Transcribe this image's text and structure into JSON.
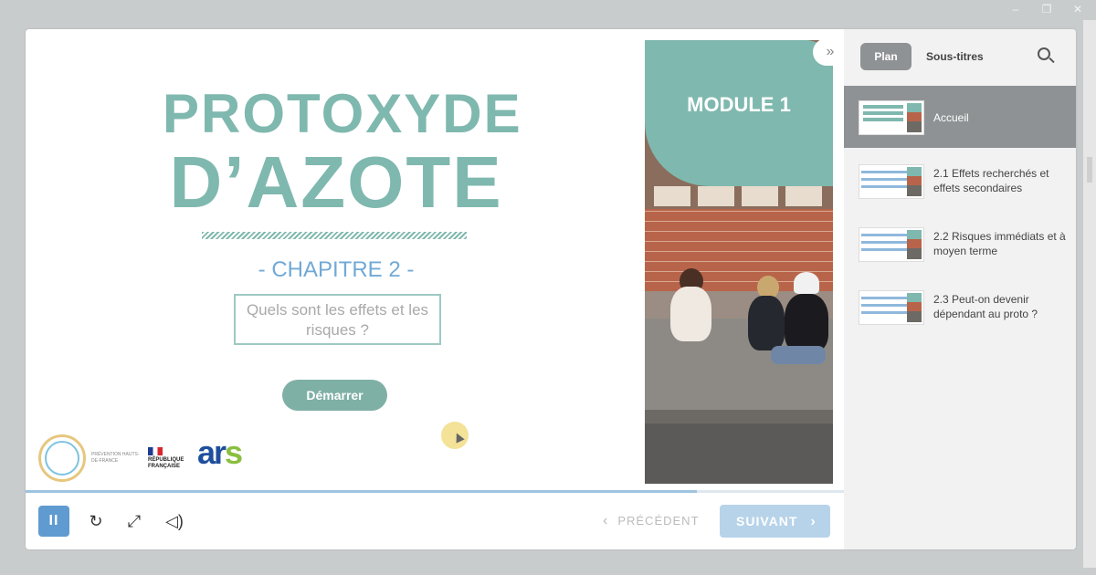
{
  "window": {
    "controls": [
      "–",
      "❐",
      "✕"
    ]
  },
  "slide": {
    "title_line1": "PROTOXYDE",
    "title_line2": "D’AZOTE",
    "chapter": "- CHAPITRE 2 -",
    "question": "Quels sont les effets et les risques ?",
    "start_button": "Démarrer",
    "module_badge": "MODULE 1",
    "logos": {
      "prevention": "PRÉVENTION HAUTS-DE-FRANCE",
      "republique": "RÉPUBLIQUE FRANÇAISE",
      "ars": "ars"
    },
    "accent_color": "#7fb8ae"
  },
  "player": {
    "progress": 0.82,
    "collapse_icon": "»",
    "controls": {
      "pause_icon": "pause-icon",
      "replay_icon": "replay-icon",
      "fullscreen_icon": "fullscreen-icon",
      "volume_icon": "volume-icon"
    },
    "prev_label": "PRÉCÉDENT",
    "next_label": "SUIVANT"
  },
  "sidebar": {
    "tabs": [
      "Plan",
      "Sous-titres"
    ],
    "search_icon": "search-icon",
    "items": [
      {
        "label": "Accueil",
        "active": true
      },
      {
        "label": "2.1 Effets recherchés et effets secondaires",
        "active": false
      },
      {
        "label": "2.2 Risques immédiats et à moyen terme",
        "active": false
      },
      {
        "label": "2.3 Peut-on devenir dépendant au proto ?",
        "active": false
      }
    ]
  }
}
